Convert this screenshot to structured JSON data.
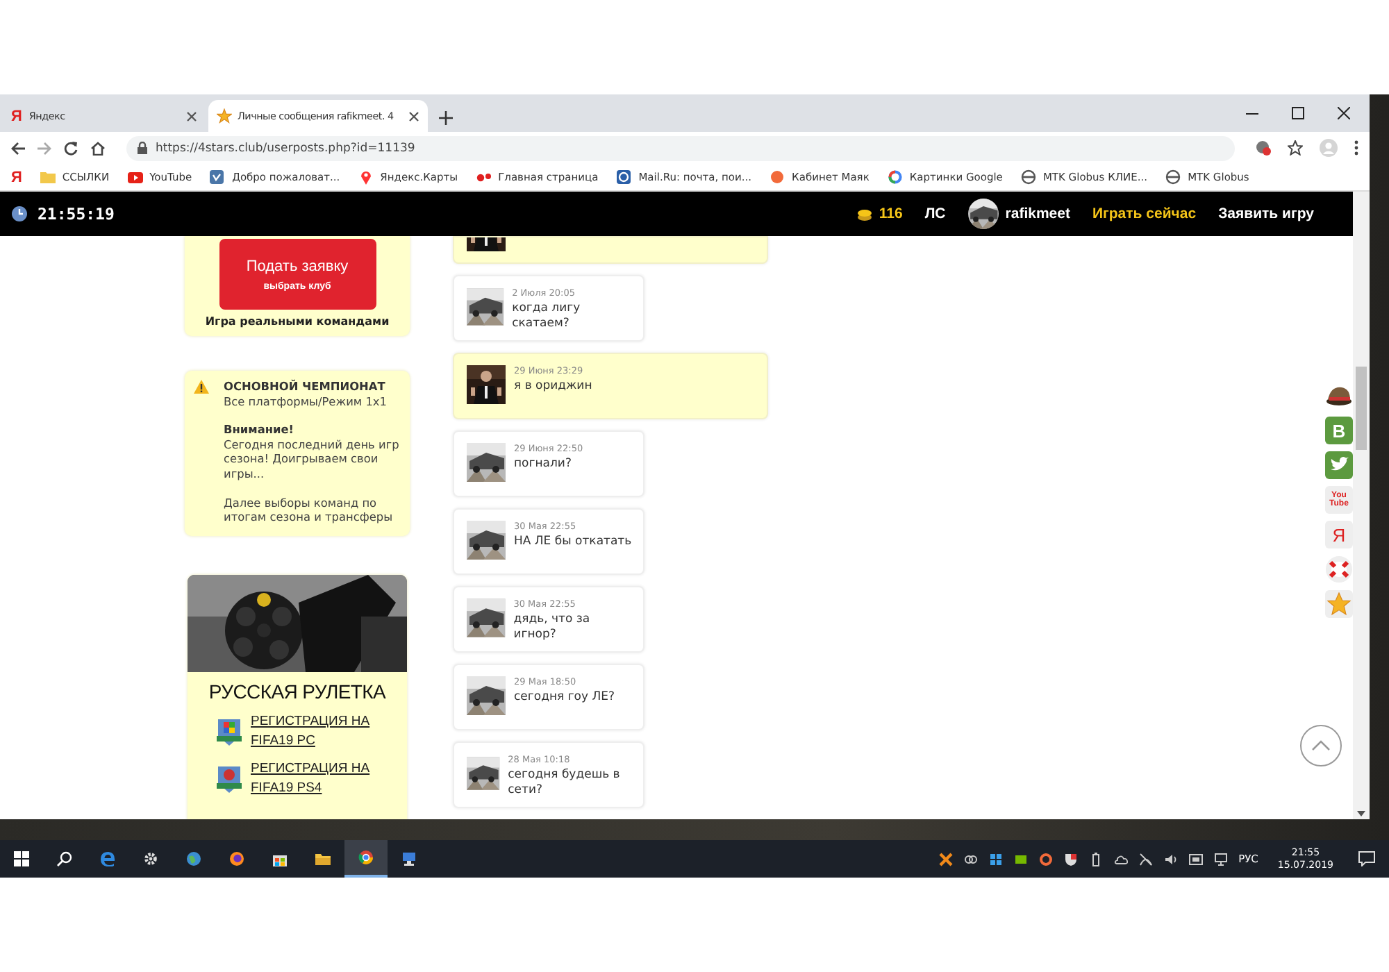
{
  "browser": {
    "tabs": [
      {
        "kind": "letter",
        "icon": "Я",
        "title": "Яндекс",
        "selected": false
      },
      {
        "kind": "star",
        "title": "Личные сообщения rafikmeet. 4",
        "selected": true
      }
    ],
    "address": "https://4stars.club/userposts.php?id=11139",
    "bookmarks_lead": "Я",
    "bookmarks": [
      {
        "kind": "folder",
        "label": "ССЫЛКИ"
      },
      {
        "kind": "youtube",
        "label": "YouTube"
      },
      {
        "kind": "vk",
        "label": "Добро пожаловат..."
      },
      {
        "kind": "pin",
        "label": "Яндекс.Карты"
      },
      {
        "kind": "dots",
        "label": "Главная страница"
      },
      {
        "kind": "mail",
        "label": "Mail.Ru: почта, пои..."
      },
      {
        "kind": "orange",
        "label": "Кабинет Маяк"
      },
      {
        "kind": "google",
        "label": "Картинки Google"
      },
      {
        "kind": "globe",
        "label": "MTK Globus КЛИЕ..."
      },
      {
        "kind": "globe",
        "label": "MTK Globus"
      }
    ]
  },
  "site_header": {
    "clock": "21:55:19",
    "coins": "116",
    "messages_link": "ЛС",
    "user": "rafikmeet",
    "links": [
      {
        "label": "Играть сейчас",
        "highlight": true
      },
      {
        "label": "Заявить игру",
        "highlight": false
      }
    ]
  },
  "apply_card": {
    "button_title": "Подать заявку",
    "button_subtitle": "выбрать клуб",
    "caption": "Игра реальными командами"
  },
  "notice_card": {
    "title": "ОСНОВНОЙ ЧЕМПИОНАТ",
    "subtitle": "Все платформы/Режим 1x1",
    "attention": "Внимание!",
    "text": "Сегодня последний день игр сезона! Доигрываем свои игры...",
    "text_2": "Далее выборы команд по итогам сезона и трансферы"
  },
  "roulette_card": {
    "title": "РУССКАЯ РУЛЕТКА",
    "links": [
      {
        "kind": "pc",
        "label": "РЕГИСТРАЦИЯ НА FIFA19 PC"
      },
      {
        "kind": "ps4",
        "label": "РЕГИСТРАЦИЯ НА FIFA19 PS4"
      }
    ]
  },
  "messages": [
    {
      "own": true,
      "partial": true
    },
    {
      "own": false,
      "partial": false,
      "date": "2 Июля 20:05",
      "text": "когда лигу скатаем?"
    },
    {
      "own": true,
      "partial": false,
      "date": "29 Июня 23:29",
      "text": "я в ориджин"
    },
    {
      "own": false,
      "partial": false,
      "date": "29 Июня 22:50",
      "text": "погнали?"
    },
    {
      "own": false,
      "partial": false,
      "date": "30 Мая 22:55",
      "text": "НА ЛЕ бы откатать"
    },
    {
      "own": false,
      "partial": false,
      "date": "30 Мая 22:55",
      "text": "дядь, что за игнор?"
    },
    {
      "own": false,
      "partial": false,
      "date": "29 Мая 18:50",
      "text": "сегодня гоу ЛЕ?"
    },
    {
      "own": false,
      "partial": false,
      "date": "28 Мая 10:18",
      "text": "сегодня будешь в сети?"
    }
  ],
  "share_buttons": [
    {
      "kind": "cap"
    },
    {
      "kind": "vk",
      "text": "В"
    },
    {
      "kind": "twitter"
    },
    {
      "kind": "youtube",
      "text": "You Tube"
    },
    {
      "kind": "yandex",
      "text": "Я"
    },
    {
      "kind": "lifebuoy"
    },
    {
      "kind": "star"
    }
  ],
  "taskbar": {
    "language": "РУС",
    "time": "21:55",
    "date": "15.07.2019"
  }
}
